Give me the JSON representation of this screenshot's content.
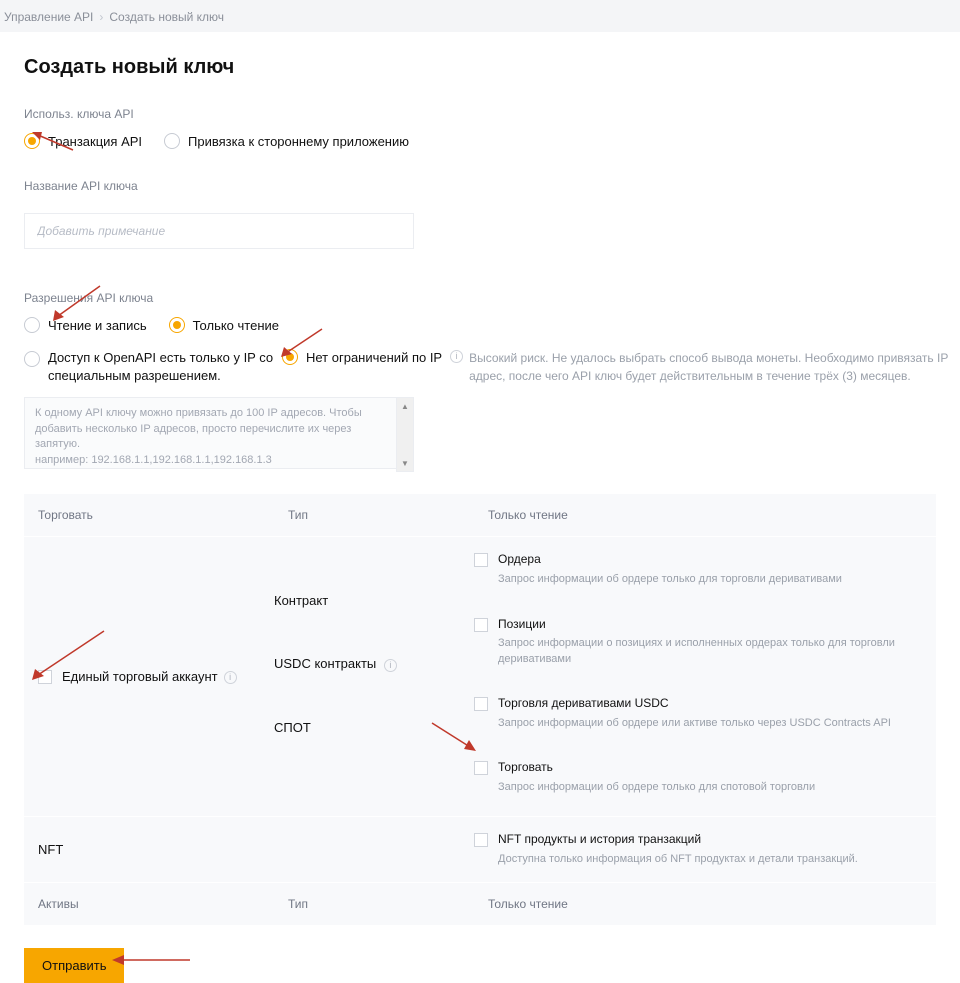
{
  "breadcrumb": {
    "a": "Управление API",
    "b": "Создать новый ключ"
  },
  "heading": "Создать новый ключ",
  "usage": {
    "label": "Использ. ключа API",
    "opt_transaction": "Транзакция API",
    "opt_bind_app": "Привязка к стороннему приложению"
  },
  "name": {
    "label": "Название API ключа",
    "placeholder": "Добавить примечание"
  },
  "perm": {
    "label": "Разрешения API ключа",
    "opt_rw": "Чтение и запись",
    "opt_ro": "Только чтение"
  },
  "ip": {
    "opt_restrict": "Доступ к OpenAPI есть только у IP со специальным разрешением.",
    "opt_norestrict": "Нет ограничений по IP",
    "risk": "Высокий риск. Не удалось выбрать способ вывода монеты. Необходимо привязать IP адрес, после чего API ключ будет действительным в течение трёх (3) месяцев.",
    "textarea": "К одному API ключу можно привязать до 100 IP адресов. Чтобы добавить несколько IP адресов, просто перечислите их через запятую.\nнапример: 192.168.1.1,192.168.1.1,192.168.1.3"
  },
  "table": {
    "col_trade": "Торговать",
    "col_type": "Тип",
    "col_ro": "Только чтение",
    "unified": "Единый торговый аккаунт",
    "type_contract": "Контракт",
    "type_usdc": "USDC контракты",
    "type_spot": "СПОТ",
    "nft": "NFT",
    "assets": "Активы",
    "r1_t": "Ордера",
    "r1_s": "Запрос информации об ордере только для торговли деривативами",
    "r2_t": "Позиции",
    "r2_s": "Запрос информации о позициях и исполненных ордерах только для торговли деривативами",
    "r3_t": "Торговля деривативами USDC",
    "r3_s": "Запрос информации об ордере или активе только через USDC Contracts API",
    "r4_t": "Торговать",
    "r4_s": "Запрос информации об ордере только для спотовой торговли",
    "r5_t": "NFT продукты и история транзакций",
    "r5_s": "Доступна только информация об NFT продуктах и детали транзакций."
  },
  "submit": "Отправить"
}
